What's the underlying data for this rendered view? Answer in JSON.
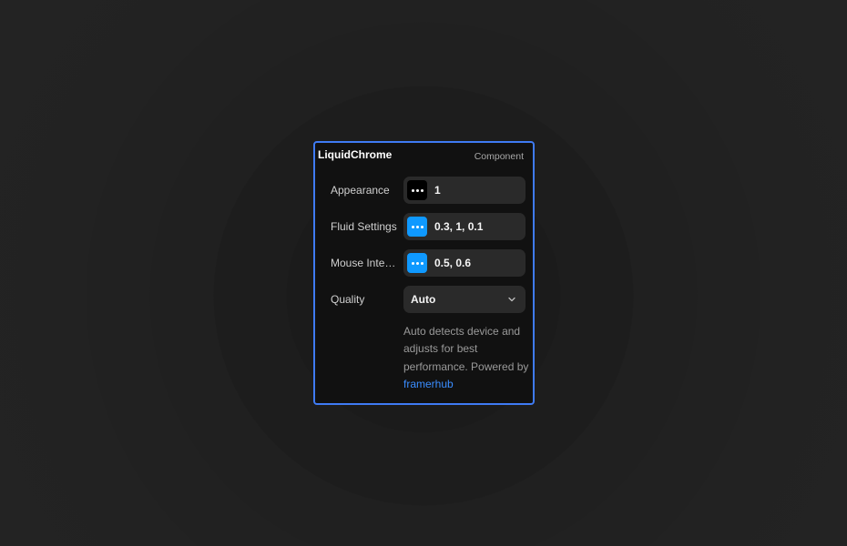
{
  "panel": {
    "title": "LiquidChrome",
    "kind": "Component"
  },
  "rows": [
    {
      "label": "Appearance",
      "value": "1",
      "swatch_color": "#000000",
      "swatch_icon": "ellipsis-icon"
    },
    {
      "label": "Fluid Settings",
      "value": "0.3, 1, 0.1",
      "swatch_color": "#0f99ff",
      "swatch_icon": "ellipsis-icon"
    },
    {
      "label": "Mouse Interaction",
      "value": "0.5, 0.6",
      "swatch_color": "#0f99ff",
      "swatch_icon": "ellipsis-icon"
    }
  ],
  "quality": {
    "label": "Quality",
    "value": "Auto",
    "icon": "chevron-down-icon"
  },
  "description": {
    "text": "Auto detects device and adjusts for best performance. Powered by",
    "link_text": "framerhub"
  },
  "colors": {
    "background": "#222222",
    "panel": "#111111",
    "selection_border": "#3f7bf4",
    "accent": "#0f99ff",
    "link": "#3a8dff"
  }
}
